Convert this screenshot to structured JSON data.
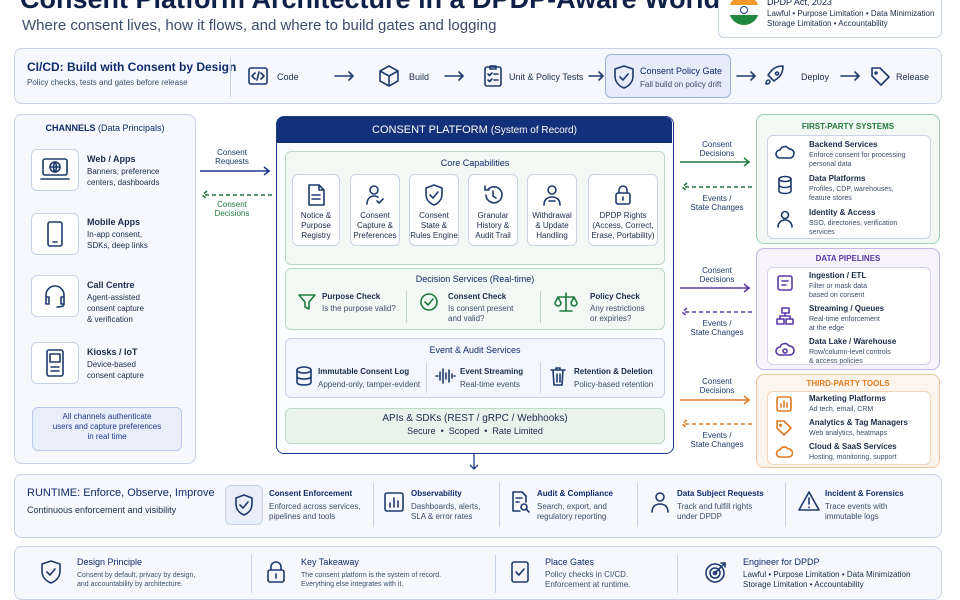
{
  "header": {
    "title": "Consent Platform Architecture in a DPDP-Aware World",
    "subtitle": "Where consent lives, how it flows, and where to build gates and logging"
  },
  "dpdp_badge": {
    "title": "DPDP Act, 2023",
    "line1": "Lawful • Purpose Limitation • Data Minimization",
    "line2": "Storage Limitation • Accountability"
  },
  "cicd": {
    "title": "CI/CD: Build with Consent by Design",
    "subtitle": "Policy checks, tests and gates before release",
    "steps": [
      {
        "label": "Code",
        "icon": "code-icon"
      },
      {
        "label": "Build",
        "icon": "package-icon"
      },
      {
        "label": "Unit & Policy Tests",
        "icon": "checklist-icon"
      },
      {
        "label": "Consent Policy Gate",
        "sub": "Fail build on policy drift",
        "icon": "shield-check-icon"
      },
      {
        "label": "Deploy",
        "icon": "rocket-icon"
      },
      {
        "label": "Release",
        "icon": "tag-icon"
      }
    ]
  },
  "channels": {
    "title": "CHANNELS",
    "title_sub": "(Data Principals)",
    "items": [
      {
        "name": "Web / Apps",
        "desc1": "Banners, preference",
        "desc2": "centers, dashboards",
        "icon": "monitor-globe-icon"
      },
      {
        "name": "Mobile Apps",
        "desc1": "In-app consent,",
        "desc2": "SDKs, deep links",
        "icon": "smartphone-icon"
      },
      {
        "name": "Call Centre",
        "desc1": "Agent-assisted",
        "desc2": "consent capture",
        "desc3": "& verification",
        "icon": "headset-icon"
      },
      {
        "name": "Kiosks / IoT",
        "desc1": "Device-based",
        "desc2": "consent capture",
        "icon": "kiosk-icon"
      }
    ],
    "note1": "All channels authenticate",
    "note2": "users and capture preferences",
    "note3": "in real time"
  },
  "flows": {
    "consent_requests": [
      "Consent",
      "Requests"
    ],
    "consent_decisions_left": [
      "Consent",
      "Decisions"
    ],
    "consent_decisions": [
      "Consent",
      "Decisions"
    ],
    "events_state": [
      "Events /",
      "State Changes"
    ]
  },
  "platform": {
    "title": "CONSENT PLATFORM",
    "title_sub": "(System of Record)",
    "core_title": "Core Capabilities",
    "core": [
      {
        "l1": "Notice &",
        "l2": "Purpose",
        "l3": "Registry",
        "icon": "document-icon"
      },
      {
        "l1": "Consent",
        "l2": "Capture &",
        "l3": "Preferences",
        "icon": "user-check-icon"
      },
      {
        "l1": "Consent",
        "l2": "State &",
        "l3": "Rules Engine",
        "icon": "shield-check-icon"
      },
      {
        "l1": "Granular",
        "l2": "History &",
        "l3": "Audit Trail",
        "icon": "history-icon"
      },
      {
        "l1": "Withdrawal",
        "l2": "& Update",
        "l3": "Handling",
        "icon": "user-withdraw-icon"
      },
      {
        "l1": "DPDP Rights",
        "l2": "(Access, Correct,",
        "l3": "Erase, Portability)",
        "icon": "lock-icon"
      }
    ],
    "decision_title": "Decision Services (Real-time)",
    "decision": [
      {
        "name": "Purpose Check",
        "desc1": "Is the purpose valid?",
        "desc2": "",
        "icon": "funnel-icon"
      },
      {
        "name": "Consent Check",
        "desc1": "Is consent present",
        "desc2": "and valid?",
        "icon": "check-circle-icon"
      },
      {
        "name": "Policy Check",
        "desc1": "Any restrictions",
        "desc2": "or expiries?",
        "icon": "scales-icon"
      }
    ],
    "event_title": "Event & Audit Services",
    "events": [
      {
        "name": "Immutable Consent Log",
        "desc": "Append-only, tamper-evident",
        "icon": "database-icon"
      },
      {
        "name": "Event Streaming",
        "desc": "Real-time events",
        "icon": "waveform-icon"
      },
      {
        "name": "Retention & Deletion",
        "desc": "Policy-based retention",
        "icon": "trash-icon"
      }
    ],
    "api_title": "APIs & SDKs (REST / gRPC / Webhooks)",
    "api_sub": "Secure  •  Scoped  •  Rate Limited"
  },
  "first_party": {
    "title": "FIRST-PARTY SYSTEMS",
    "items": [
      {
        "name": "Backend Services",
        "d1": "Enforce consent for processing",
        "d2": "personal data",
        "icon": "cloud-icon"
      },
      {
        "name": "Data Platforms",
        "d1": "Profiles, CDP, warehouses,",
        "d2": "feature stores",
        "icon": "database-icon"
      },
      {
        "name": "Identity & Access",
        "d1": "SSO, directories, verification",
        "d2": "services",
        "icon": "user-icon"
      }
    ]
  },
  "pipelines": {
    "title": "DATA PIPELINES",
    "items": [
      {
        "name": "Ingestion / ETL",
        "d1": "Filter or mask data",
        "d2": "based on consent",
        "icon": "ingest-icon"
      },
      {
        "name": "Streaming / Queues",
        "d1": "Real-time enforcement",
        "d2": "at the edge",
        "icon": "stream-icon"
      },
      {
        "name": "Data Lake / Warehouse",
        "d1": "Row/column-level controls",
        "d2": "& access policies",
        "icon": "cloud-gear-icon"
      }
    ]
  },
  "third_party": {
    "title": "THIRD-PARTY TOOLS",
    "items": [
      {
        "name": "Marketing Platforms",
        "d1": "Ad tech, email, CRM",
        "icon": "chart-icon"
      },
      {
        "name": "Analytics & Tag Managers",
        "d1": "Web analytics, heatmaps",
        "icon": "tag-icon"
      },
      {
        "name": "Cloud & SaaS Services",
        "d1": "Hosting, monitoring, support",
        "icon": "cloud-icon"
      }
    ]
  },
  "runtime": {
    "title": "RUNTIME: Enforce, Observe, Improve",
    "subtitle": "Continuous enforcement and visibility",
    "items": [
      {
        "name": "Consent Enforcement",
        "d1": "Enforced across services,",
        "d2": "pipelines and tools",
        "icon": "shield-check-icon"
      },
      {
        "name": "Observability",
        "d1": "Dashboards, alerts,",
        "d2": "SLA & error rates",
        "icon": "bar-chart-icon"
      },
      {
        "name": "Audit & Compliance",
        "d1": "Search, export, and",
        "d2": "regulatory reporting",
        "icon": "doc-search-icon"
      },
      {
        "name": "Data Subject Requests",
        "d1": "Track and fulfill rights",
        "d2": "under DPDP",
        "icon": "user-icon"
      },
      {
        "name": "Incident & Forensics",
        "d1": "Trace events with",
        "d2": "immutable logs",
        "icon": "warning-icon"
      }
    ]
  },
  "footer": {
    "items": [
      {
        "name": "Design Principle",
        "d1": "Consent by default, privacy by design,",
        "d2": "and accountability by architecture.",
        "icon": "shield-check-icon"
      },
      {
        "name": "Key Takeaway",
        "d1": "The consent platform is the system of record.",
        "d2": "Everything else integrates with it.",
        "icon": "lock-icon"
      },
      {
        "name": "Place Gates",
        "d1": "Policy checks in CI/CD.",
        "d2": "Enforcement at runtime.",
        "icon": "checklist-icon"
      },
      {
        "name": "Engineer for DPDP",
        "d1": "Lawful • Purpose Limitation • Data Minimization",
        "d2": "Storage Limitation • Accountability",
        "icon": "target-icon"
      }
    ]
  },
  "colors": {
    "navy": "#0f2b6b",
    "green": "#1f7a3e",
    "purple": "#5b3aa8",
    "orange": "#e07a1f",
    "flag_saffron": "#f39a2b",
    "flag_green": "#1f8a3e"
  }
}
